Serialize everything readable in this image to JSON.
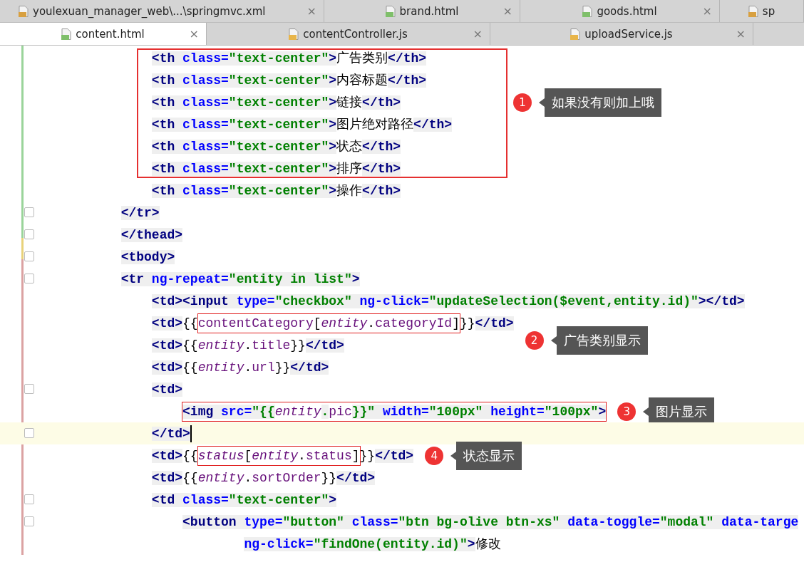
{
  "tab_rows": [
    {
      "tabs": [
        {
          "label": "youlexuan_manager_web\\...\\springmvc.xml",
          "kind": "xml",
          "close": "×",
          "selected": false
        },
        {
          "label": "brand.html",
          "kind": "html",
          "close": "×",
          "selected": false
        },
        {
          "label": "goods.html",
          "kind": "html",
          "close": "×",
          "selected": false
        },
        {
          "label": "sp",
          "kind": "xml",
          "selected": false
        }
      ]
    },
    {
      "tabs": [
        {
          "label": "content.html",
          "kind": "html",
          "close": "×",
          "selected": true
        },
        {
          "label": "contentController.js",
          "kind": "js",
          "close": "×",
          "selected": false
        },
        {
          "label": "uploadService.js",
          "kind": "js",
          "close": "×",
          "selected": false
        }
      ]
    }
  ],
  "code": [
    {
      "kind": "group",
      "callout": {
        "number": "1",
        "text": "如果没有则加上哦"
      },
      "lines": [
        {
          "current": false,
          "fold": false,
          "segs": [
            {
              "boxed": false,
              "tokens": [
                {
                  "kind": "tag",
                  "text": "                <th"
                },
                {
                  "kind": "attr",
                  "text": " class="
                },
                {
                  "kind": "str",
                  "text": "\"text-center\""
                },
                {
                  "kind": "tag",
                  "text": ">"
                },
                {
                  "kind": "txt",
                  "text": "广告类别"
                },
                {
                  "kind": "tag",
                  "text": "</th>"
                }
              ]
            }
          ]
        },
        {
          "current": false,
          "fold": false,
          "segs": [
            {
              "boxed": false,
              "tokens": [
                {
                  "kind": "tag",
                  "text": "                <th"
                },
                {
                  "kind": "attr",
                  "text": " class="
                },
                {
                  "kind": "str",
                  "text": "\"text-center\""
                },
                {
                  "kind": "tag",
                  "text": ">"
                },
                {
                  "kind": "txt",
                  "text": "内容标题"
                },
                {
                  "kind": "tag",
                  "text": "</th>"
                }
              ]
            }
          ]
        },
        {
          "current": false,
          "fold": false,
          "segs": [
            {
              "boxed": false,
              "tokens": [
                {
                  "kind": "tag",
                  "text": "                <th"
                },
                {
                  "kind": "attr",
                  "text": " class="
                },
                {
                  "kind": "str",
                  "text": "\"text-center\""
                },
                {
                  "kind": "tag",
                  "text": ">"
                },
                {
                  "kind": "txt",
                  "text": "链接"
                },
                {
                  "kind": "tag",
                  "text": "</th>"
                }
              ]
            }
          ]
        },
        {
          "current": false,
          "fold": false,
          "segs": [
            {
              "boxed": false,
              "tokens": [
                {
                  "kind": "tag",
                  "text": "                <th"
                },
                {
                  "kind": "attr",
                  "text": " class="
                },
                {
                  "kind": "str",
                  "text": "\"text-center\""
                },
                {
                  "kind": "tag",
                  "text": ">"
                },
                {
                  "kind": "txt",
                  "text": "图片绝对路径"
                },
                {
                  "kind": "tag",
                  "text": "</th>"
                }
              ]
            }
          ]
        },
        {
          "current": false,
          "fold": false,
          "segs": [
            {
              "boxed": false,
              "tokens": [
                {
                  "kind": "tag",
                  "text": "                <th"
                },
                {
                  "kind": "attr",
                  "text": " class="
                },
                {
                  "kind": "str",
                  "text": "\"text-center\""
                },
                {
                  "kind": "tag",
                  "text": ">"
                },
                {
                  "kind": "txt",
                  "text": "状态"
                },
                {
                  "kind": "tag",
                  "text": "</th>"
                }
              ]
            }
          ]
        },
        {
          "current": false,
          "fold": false,
          "segs": [
            {
              "boxed": false,
              "tokens": [
                {
                  "kind": "tag",
                  "text": "                <th"
                },
                {
                  "kind": "attr",
                  "text": " class="
                },
                {
                  "kind": "str",
                  "text": "\"text-center\""
                },
                {
                  "kind": "tag",
                  "text": ">"
                },
                {
                  "kind": "txt",
                  "text": "排序"
                },
                {
                  "kind": "tag",
                  "text": "</th>"
                }
              ]
            }
          ]
        }
      ]
    },
    {
      "kind": "line",
      "current": false,
      "fold": false,
      "segs": [
        {
          "boxed": false,
          "tokens": [
            {
              "kind": "tag",
              "text": "                <th"
            },
            {
              "kind": "attr",
              "text": " class="
            },
            {
              "kind": "str",
              "text": "\"text-center\""
            },
            {
              "kind": "tag",
              "text": ">"
            },
            {
              "kind": "txt",
              "text": "操作"
            },
            {
              "kind": "tag",
              "text": "</th>"
            }
          ]
        }
      ]
    },
    {
      "kind": "line",
      "current": false,
      "fold": true,
      "segs": [
        {
          "boxed": false,
          "tokens": [
            {
              "kind": "tag",
              "text": "            </tr>"
            }
          ]
        }
      ]
    },
    {
      "kind": "line",
      "current": false,
      "fold": true,
      "segs": [
        {
          "boxed": false,
          "tokens": [
            {
              "kind": "tag",
              "text": "            </thead>"
            }
          ]
        }
      ]
    },
    {
      "kind": "line",
      "current": false,
      "fold": true,
      "segs": [
        {
          "boxed": false,
          "tokens": [
            {
              "kind": "tag",
              "text": "            <tbody>"
            }
          ]
        }
      ]
    },
    {
      "kind": "line",
      "current": false,
      "fold": true,
      "segs": [
        {
          "boxed": false,
          "tokens": [
            {
              "kind": "tag",
              "text": "            <tr"
            },
            {
              "kind": "attr",
              "text": " ng-repeat="
            },
            {
              "kind": "str",
              "text": "\"entity in list\""
            },
            {
              "kind": "tag",
              "text": ">"
            }
          ]
        }
      ]
    },
    {
      "kind": "line",
      "current": false,
      "fold": false,
      "segs": [
        {
          "boxed": false,
          "tokens": [
            {
              "kind": "tag",
              "text": "                <td><input"
            },
            {
              "kind": "attr",
              "text": " type="
            },
            {
              "kind": "str",
              "text": "\"checkbox\""
            },
            {
              "kind": "attr",
              "text": " ng-click="
            },
            {
              "kind": "str",
              "text": "\"updateSelection($event,entity.id)\""
            },
            {
              "kind": "tag",
              "text": "></td>"
            }
          ]
        }
      ]
    },
    {
      "kind": "line",
      "current": false,
      "fold": false,
      "callout": {
        "number": "2",
        "text": "广告类别显示"
      },
      "segs": [
        {
          "boxed": false,
          "tokens": [
            {
              "kind": "tag",
              "text": "                <td>"
            },
            {
              "kind": "txt",
              "text": "{{"
            }
          ]
        },
        {
          "boxed": true,
          "tokens": [
            {
              "kind": "prop",
              "text": "contentCategory"
            },
            {
              "kind": "txt",
              "text": "["
            },
            {
              "kind": "ivar",
              "text": "entity"
            },
            {
              "kind": "txt",
              "text": "."
            },
            {
              "kind": "prop",
              "text": "categoryId"
            },
            {
              "kind": "txt",
              "text": "]"
            }
          ]
        },
        {
          "boxed": false,
          "tokens": [
            {
              "kind": "txt",
              "text": "}}"
            },
            {
              "kind": "tag",
              "text": "</td>"
            }
          ]
        }
      ]
    },
    {
      "kind": "line",
      "current": false,
      "fold": false,
      "segs": [
        {
          "boxed": false,
          "tokens": [
            {
              "kind": "tag",
              "text": "                <td>"
            },
            {
              "kind": "txt",
              "text": "{{"
            },
            {
              "kind": "ivar",
              "text": "entity"
            },
            {
              "kind": "txt",
              "text": "."
            },
            {
              "kind": "prop",
              "text": "title"
            },
            {
              "kind": "txt",
              "text": "}}"
            },
            {
              "kind": "tag",
              "text": "</td>"
            }
          ]
        }
      ]
    },
    {
      "kind": "line",
      "current": false,
      "fold": false,
      "segs": [
        {
          "boxed": false,
          "tokens": [
            {
              "kind": "tag",
              "text": "                <td>"
            },
            {
              "kind": "txt",
              "text": "{{"
            },
            {
              "kind": "ivar",
              "text": "entity"
            },
            {
              "kind": "txt",
              "text": "."
            },
            {
              "kind": "prop",
              "text": "url"
            },
            {
              "kind": "txt",
              "text": "}}"
            },
            {
              "kind": "tag",
              "text": "</td>"
            }
          ]
        }
      ]
    },
    {
      "kind": "line",
      "current": false,
      "fold": true,
      "segs": [
        {
          "boxed": false,
          "tokens": [
            {
              "kind": "tag",
              "text": "                <td>"
            }
          ]
        }
      ]
    },
    {
      "kind": "line",
      "current": false,
      "fold": false,
      "callout": {
        "number": "3",
        "text": "图片显示"
      },
      "segs": [
        {
          "boxed": true,
          "tokens": [
            {
              "kind": "tag",
              "text": "                    <img"
            },
            {
              "kind": "attr",
              "text": " src="
            },
            {
              "kind": "str",
              "text": "\"{{"
            },
            {
              "kind": "ivar",
              "text": "entity"
            },
            {
              "kind": "str",
              "text": "."
            },
            {
              "kind": "prop",
              "text": "pic"
            },
            {
              "kind": "str",
              "text": "}}\""
            },
            {
              "kind": "attr",
              "text": " width="
            },
            {
              "kind": "str",
              "text": "\"100px\""
            },
            {
              "kind": "attr",
              "text": " height="
            },
            {
              "kind": "str",
              "text": "\"100px\""
            },
            {
              "kind": "tag",
              "text": ">"
            }
          ]
        }
      ]
    },
    {
      "kind": "line",
      "current": true,
      "fold": true,
      "segs": [
        {
          "boxed": false,
          "tokens": [
            {
              "kind": "tag",
              "text": "                </td>"
            }
          ]
        }
      ]
    },
    {
      "kind": "line",
      "current": false,
      "fold": false,
      "callout": {
        "number": "4",
        "text": "状态显示"
      },
      "segs": [
        {
          "boxed": false,
          "tokens": [
            {
              "kind": "tag",
              "text": "                <td>"
            },
            {
              "kind": "txt",
              "text": "{{"
            }
          ]
        },
        {
          "boxed": true,
          "tokens": [
            {
              "kind": "ivar",
              "text": "status"
            },
            {
              "kind": "txt",
              "text": "["
            },
            {
              "kind": "ivar",
              "text": "entity"
            },
            {
              "kind": "txt",
              "text": "."
            },
            {
              "kind": "prop",
              "text": "status"
            },
            {
              "kind": "txt",
              "text": "]"
            }
          ]
        },
        {
          "boxed": false,
          "tokens": [
            {
              "kind": "txt",
              "text": "}}"
            },
            {
              "kind": "tag",
              "text": "</td>"
            }
          ]
        }
      ]
    },
    {
      "kind": "line",
      "current": false,
      "fold": false,
      "segs": [
        {
          "boxed": false,
          "tokens": [
            {
              "kind": "tag",
              "text": "                <td>"
            },
            {
              "kind": "txt",
              "text": "{{"
            },
            {
              "kind": "ivar",
              "text": "entity"
            },
            {
              "kind": "txt",
              "text": "."
            },
            {
              "kind": "prop",
              "text": "sortOrder"
            },
            {
              "kind": "txt",
              "text": "}}"
            },
            {
              "kind": "tag",
              "text": "</td>"
            }
          ]
        }
      ]
    },
    {
      "kind": "line",
      "current": false,
      "fold": true,
      "segs": [
        {
          "boxed": false,
          "tokens": [
            {
              "kind": "tag",
              "text": "                <td"
            },
            {
              "kind": "attr",
              "text": " class="
            },
            {
              "kind": "str",
              "text": "\"text-center\""
            },
            {
              "kind": "tag",
              "text": ">"
            }
          ]
        }
      ]
    },
    {
      "kind": "line",
      "current": false,
      "fold": true,
      "segs": [
        {
          "boxed": false,
          "tokens": [
            {
              "kind": "tag",
              "text": "                    <button"
            },
            {
              "kind": "attr",
              "text": " type="
            },
            {
              "kind": "str",
              "text": "\"button\""
            },
            {
              "kind": "attr",
              "text": " class="
            },
            {
              "kind": "str",
              "text": "\"btn bg-olive btn-xs\""
            },
            {
              "kind": "attr",
              "text": " data-toggle="
            },
            {
              "kind": "str",
              "text": "\"modal\""
            },
            {
              "kind": "attr",
              "text": " data-targe"
            }
          ]
        }
      ]
    },
    {
      "kind": "line",
      "current": false,
      "fold": false,
      "segs": [
        {
          "boxed": false,
          "tokens": [
            {
              "kind": "attr",
              "text": "                            ng-click="
            },
            {
              "kind": "str",
              "text": "\"findOne(entity.id)\""
            },
            {
              "kind": "tag",
              "text": ">"
            },
            {
              "kind": "txt",
              "text": "修改"
            }
          ]
        }
      ]
    }
  ]
}
